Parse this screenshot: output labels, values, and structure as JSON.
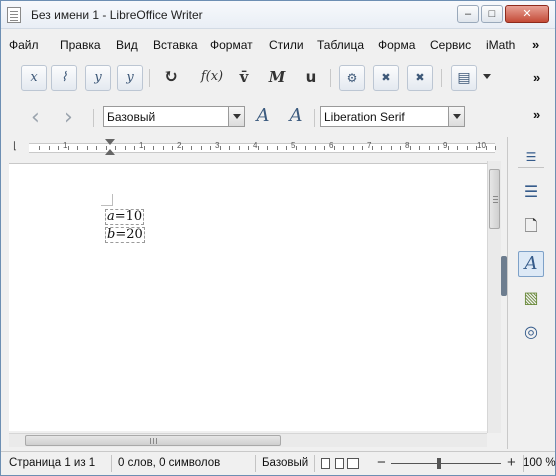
{
  "window": {
    "title": "Без имени 1 - LibreOffice Writer",
    "controls": {
      "minimize": "–",
      "maximize": "□",
      "close": "✕"
    }
  },
  "menu": {
    "items": [
      "Файл",
      "Правка",
      "Вид",
      "Вставка",
      "Формат",
      "Стили",
      "Таблица",
      "Форма",
      "Сервис",
      "iMath"
    ],
    "overflow": "»"
  },
  "toolbar_math": {
    "buttons": [
      {
        "icon": "imath-x-icon",
        "glyph": "x"
      },
      {
        "icon": "imath-graph-icon",
        "glyph": "⌇"
      },
      {
        "icon": "imath-y-icon",
        "glyph": "y"
      },
      {
        "icon": "imath-y2-icon",
        "glyph": "y"
      },
      {
        "icon": "refresh-icon",
        "glyph": "↻"
      },
      {
        "icon": "function-icon",
        "glyph": "f(x)"
      },
      {
        "icon": "vector-icon",
        "glyph": "v̄"
      },
      {
        "icon": "matrix-icon",
        "glyph": "M"
      },
      {
        "icon": "unit-icon",
        "glyph": "u"
      },
      {
        "icon": "settings-doc-icon",
        "glyph": "⚙"
      },
      {
        "icon": "delete-doc-icon",
        "glyph": "✖"
      },
      {
        "icon": "delete-all-doc-icon",
        "glyph": "✖"
      },
      {
        "icon": "insert-doc-icon",
        "glyph": "▤"
      }
    ],
    "overflow": "»"
  },
  "toolbar_format": {
    "back_arrow": "‹",
    "forward_arrow": "›",
    "paragraph_style": "Базовый",
    "font_name": "Liberation Serif",
    "overflow": "»"
  },
  "ruler": {
    "numbers": [
      "1",
      "1",
      "2",
      "3",
      "4",
      "5",
      "6",
      "7",
      "8",
      "9",
      "10"
    ]
  },
  "document": {
    "formulas": [
      {
        "var": "a",
        "rest": "=10"
      },
      {
        "var": "b",
        "rest": "=20"
      }
    ]
  },
  "sidebar": {
    "buttons": [
      {
        "icon": "properties-icon",
        "glyph": "☰"
      },
      {
        "icon": "page-icon",
        "glyph": "🗋"
      },
      {
        "icon": "styles-icon",
        "glyph": "A"
      },
      {
        "icon": "gallery-icon",
        "glyph": "▧"
      },
      {
        "icon": "navigator-icon",
        "glyph": "◎"
      }
    ],
    "active": "styles-icon"
  },
  "statusbar": {
    "page": "Страница 1 из 1",
    "words": "0 слов, 0 символов",
    "style": "Базовый",
    "zoom_percent": "100 %",
    "zoom_level": 0.42
  }
}
